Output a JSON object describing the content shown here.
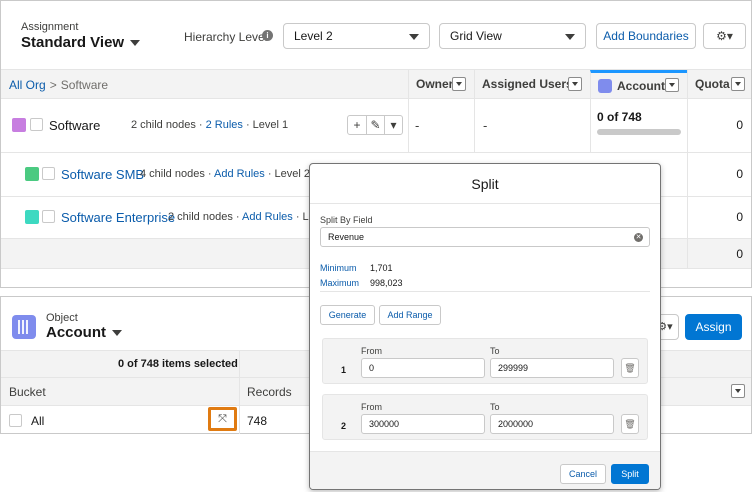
{
  "header": {
    "assignment_label": "Assignment",
    "view_title": "Standard View",
    "hierarchy_label": "Hierarchy Level",
    "hierarchy_value": "Level 2",
    "view_mode": "Grid View",
    "add_boundaries": "Add Boundaries"
  },
  "breadcrumb": {
    "root": "All Org",
    "sep": ">",
    "current": "Software"
  },
  "columns": {
    "owner": "Owner",
    "assigned_users": "Assigned Users",
    "account": "Account",
    "quota": "Quota"
  },
  "rows": [
    {
      "name": "Software",
      "color": "#c77ee0",
      "meta_children": "2 child nodes · ",
      "meta_rules": "2 Rules",
      "meta_level": " · Level 1",
      "owner": "-",
      "assigned": "-",
      "account": "0 of 748",
      "quota": "0"
    },
    {
      "name": "Software SMB",
      "color": "#4bca81",
      "meta_children": "4 child nodes · ",
      "meta_rules": "Add Rules",
      "meta_level": " · Level 2",
      "quota": "0"
    },
    {
      "name": "Software Enterprise",
      "color": "#3dd9c1",
      "meta_children": "2 child nodes · ",
      "meta_rules": "Add Rules",
      "meta_level": " · Level 2",
      "quota": "0"
    },
    {
      "quota": "0"
    }
  ],
  "row_actions": {
    "add": "+",
    "edit": "✎",
    "more": "▾"
  },
  "object": {
    "label": "Object",
    "title": "Account",
    "assign": "Assign",
    "selected": "0 of 748 items selected",
    "bucket_header": "Bucket",
    "records_header": "Records",
    "all_label": "All",
    "all_records": "748"
  },
  "modal": {
    "title": "Split",
    "split_by_label": "Split By Field",
    "split_by_value": "Revenue",
    "minimum_label": "Minimum",
    "minimum_value": "1,701",
    "maximum_label": "Maximum",
    "maximum_value": "998,023",
    "generate": "Generate",
    "add_range": "Add Range",
    "from_label": "From",
    "to_label": "To",
    "ranges": [
      {
        "index": "1",
        "from": "0",
        "to": "299999"
      },
      {
        "index": "2",
        "from": "300000",
        "to": "2000000"
      }
    ],
    "cancel": "Cancel",
    "split": "Split"
  }
}
